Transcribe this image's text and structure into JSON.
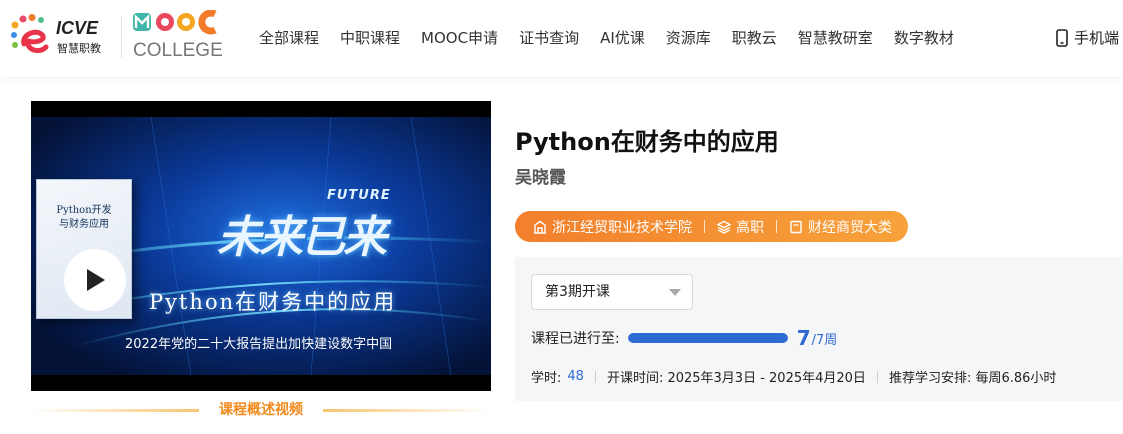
{
  "logo": {
    "icve_text": "ICVE",
    "icve_sub": "智慧职教",
    "mooc_text": "MOOC",
    "college_text": "COLLEGE"
  },
  "nav": {
    "items": [
      {
        "label": "全部课程"
      },
      {
        "label": "中职课程"
      },
      {
        "label": "MOOC申请"
      },
      {
        "label": "证书查询"
      },
      {
        "label": "AI优课"
      },
      {
        "label": "资源库"
      },
      {
        "label": "职教云"
      },
      {
        "label": "智慧教研室"
      },
      {
        "label": "数字教材"
      }
    ],
    "mobile_label": "手机端"
  },
  "video": {
    "book_title": "Python开发\n与财务应用",
    "big_title": "未来已来",
    "future_label": "FUTURE",
    "subtitle": "Python在财务中的应用",
    "caption": "2022年党的二十大报告提出加快建设数字中国",
    "overview_label": "课程概述视频"
  },
  "course": {
    "title": "Python在财务中的应用",
    "teacher": "吴晓霞",
    "tags": [
      {
        "label": "浙江经贸职业技术学院",
        "icon": "building-icon"
      },
      {
        "label": "高职",
        "icon": "layers-icon"
      },
      {
        "label": "财经商贸大类",
        "icon": "book-icon"
      }
    ],
    "term": "第3期开课",
    "progress_label": "课程已进行至:",
    "progress_current": "7",
    "progress_total": "/7周",
    "progress_fraction": 1.0,
    "hours_label": "学时:",
    "hours_value": "48",
    "schedule": "开课时间: 2025年3月3日 - 2025年4月20日",
    "study_plan": "推荐学习安排: 每周6.86小时"
  },
  "colors": {
    "accent_blue": "#2e6ad2",
    "tag_orange": "#f5922f",
    "overview_orange": "#f08a1c"
  }
}
